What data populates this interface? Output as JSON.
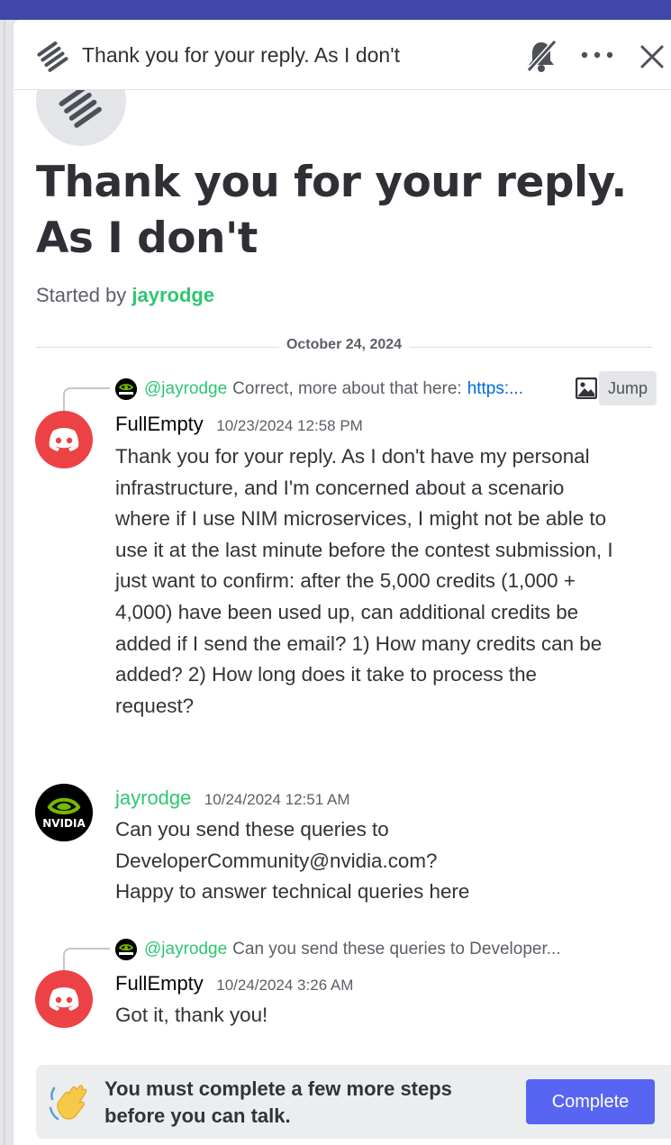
{
  "header": {
    "title": "Thank you for your reply. As I don't"
  },
  "thread": {
    "title": "Thank you for your reply. As I don't",
    "started_by_prefix": "Started by",
    "started_by_user": "jayrodge"
  },
  "date_divider": "October 24, 2024",
  "messages": [
    {
      "reply_to": {
        "mention": "@jayrodge",
        "text": "Correct, more about that here:",
        "link": "https:...",
        "jump_label": "Jump"
      },
      "author": "FullEmpty",
      "timestamp": "10/23/2024 12:58 PM",
      "body": "Thank you for your reply. As I don't have my personal infrastructure, and I'm concerned about a scenario where if I use NIM microservices, I might not be able to use it at the last minute before the contest submission, I just want to confirm: after the 5,000 credits (1,000 + 4,000) have been used up, can additional credits be added if I send the email? 1) How many credits can be added? 2) How long does it take to process the request?"
    },
    {
      "author": "jayrodge",
      "timestamp": "10/24/2024 12:51 AM",
      "body_lines": [
        "Can you send these queries to",
        "DeveloperCommunity@nvidia.com?",
        "Happy to answer technical queries here"
      ]
    },
    {
      "reply_to": {
        "mention": "@jayrodge",
        "text": "Can you send these queries to Developer..."
      },
      "author": "FullEmpty",
      "timestamp": "10/24/2024 3:26 AM",
      "body": "Got it, thank you!"
    }
  ],
  "notice": {
    "text": "You must complete a few more steps before you can talk.",
    "button_label": "Complete"
  },
  "colors": {
    "accent": "#5865f2",
    "mention_green": "#2dc770",
    "link_blue": "#0068e0",
    "discord_red": "#ed4245",
    "nvidia_green": "#76b900",
    "top_bar": "#3f47a8"
  },
  "icons": {
    "thread": "thread-icon",
    "mute": "bell-slash-icon",
    "more": "more-icon",
    "close": "close-icon",
    "image": "image-icon",
    "discord_avatar": "discord-logo-icon",
    "nvidia_avatar": "nvidia-logo-icon",
    "wave": "wave-hand-icon"
  }
}
